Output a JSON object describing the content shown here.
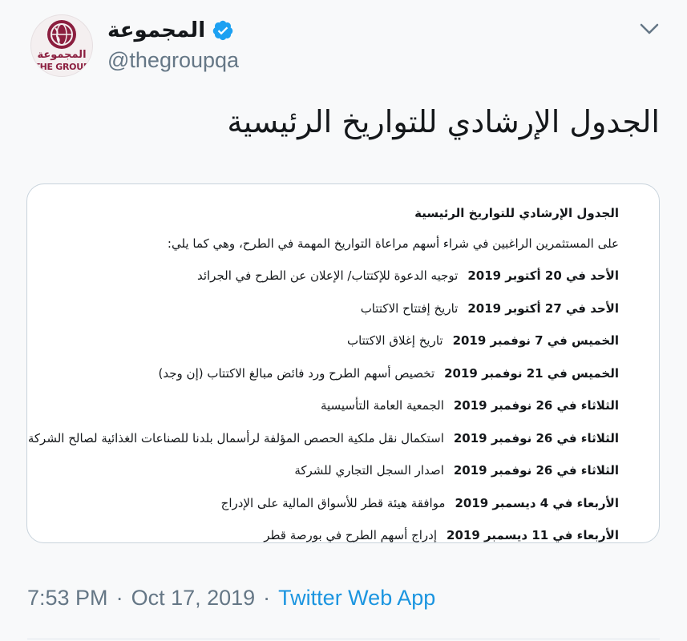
{
  "user": {
    "display_name": "المجموعة",
    "handle": "@thegroupqa",
    "avatar_text_ar": "المجموعة",
    "avatar_text_en": "THE GROUP",
    "verified": true
  },
  "tweet": {
    "text": "الجدول الإرشادي للتواريخ الرئيسية"
  },
  "image_doc": {
    "title": "الجدول الإرشادي للتواريخ الرئيسية",
    "intro": "على المستثمرين الراغبين في شراء أسهم مراعاة التواريخ المهمة في الطرح، وهي كما يلي:",
    "rows": [
      {
        "date": "الأحد في 20 أكتوبر 2019",
        "event": "توجيه الدعوة للإكتتاب/ الإعلان عن الطرح في الجرائد"
      },
      {
        "date": "الأحد في 27 أكتوبر 2019",
        "event": "تاريخ إفتتاح الاكتتاب"
      },
      {
        "date": "الخميس في 7 نوفمبر 2019",
        "event": "تاريخ إغلاق الاكتتاب"
      },
      {
        "date": "الخميس في 21 نوفمبر 2019",
        "event": "تخصيص أسهم الطرح ورد فائض مبالغ الاكتتاب (إن وجد)"
      },
      {
        "date": "الثلاثاء في 26 نوفمبر 2019",
        "event": "الجمعية العامة التأسيسية"
      },
      {
        "date": "الثلاثاء في 26 نوفمبر 2019",
        "event": "استكمال نقل ملكية الحصص المؤلفة لرأسمال بلدنا للصناعات الغذائية لصالح الشركة"
      },
      {
        "date": "الثلاثاء في 26 نوفمبر 2019",
        "event": "اصدار السجل التجاري للشركة"
      },
      {
        "date": "الأربعاء في 4 ديسمبر 2019",
        "event": "موافقة هيئة قطر للأسواق المالية على الإدراج"
      },
      {
        "date": "الأربعاء في 11 ديسمبر 2019",
        "event": "إدراج أسهم الطرح في بورصة قطر"
      }
    ]
  },
  "meta": {
    "time": "7:53 PM",
    "separator": "·",
    "date": "Oct 17, 2019",
    "source": "Twitter Web App"
  },
  "icons": {
    "verified": "verified-badge-icon",
    "caret": "chevron-down-icon",
    "globe": "globe-logo-icon"
  },
  "colors": {
    "brand": "#8b1e3f",
    "link": "#1b95e0",
    "secondary_text": "#657786",
    "verified_blue": "#1da1f2"
  }
}
